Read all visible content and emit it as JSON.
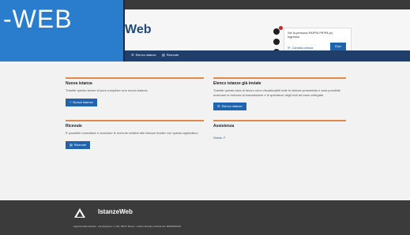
{
  "header": {
    "logo_text": "-WEB",
    "brand_suffix": "Web",
    "user": {
      "welcome_text": "Sei la persona PAPPA PIPPA (c) ingresso",
      "change_profile_label": "Cambia utenza",
      "exit_label": "Esci"
    }
  },
  "nav": {
    "items": [
      {
        "label": "Elenco istanze",
        "icon": "list-icon"
      },
      {
        "label": "Ricevute",
        "icon": "receipt-icon"
      }
    ]
  },
  "cards": {
    "new_request": {
      "title": "Nuova istanza",
      "text": "Tramite questo lavoro di puoi compilare una nuova istanza.",
      "button": "Nuova istanza"
    },
    "sent_requests": {
      "title": "Elenco istanze già inviate",
      "text": "Tramite questa area di lavoro sono visualizzabili tutte le istanze presentate e sarà possibile scaricare la ricevuta di trasmissione e le quietanze degli invii ad esse collegate.",
      "button": "Elenco istanze"
    },
    "receipts": {
      "title": "Ricevute",
      "text": "È possibile consultare e scaricare le ricevute relative alle istanze inviate con questo applicativo.",
      "button": "Ricevute"
    },
    "assistance": {
      "title": "Assistenza",
      "link": "Guida"
    }
  },
  "footer": {
    "brand": "IstanzeWeb",
    "text": "Agenzia delle Entrate - via Giorgione n. 106, 00147 Roma - Codice Fiscale e Partita Iva: 06363391001"
  }
}
